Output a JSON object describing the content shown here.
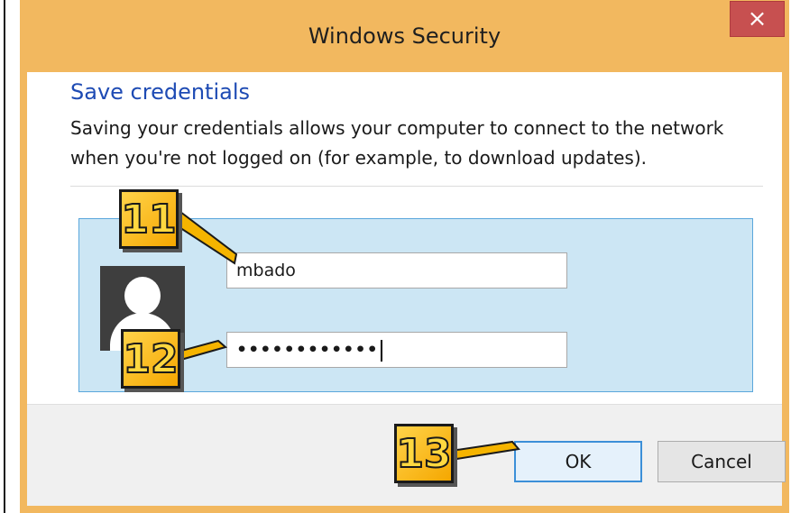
{
  "window": {
    "title": "Windows Security",
    "close_glyph": "×"
  },
  "dialog": {
    "heading": "Save credentials",
    "description": "Saving your credentials allows your computer to connect to the network when you're not logged on (for example, to download updates)."
  },
  "fields": {
    "username_value": "mbado",
    "password_masked": "••••••••••••"
  },
  "buttons": {
    "ok": "OK",
    "cancel": "Cancel"
  },
  "callouts": [
    "11",
    "12",
    "13"
  ],
  "icons": {
    "avatar": "user-avatar-icon",
    "close": "close-icon"
  },
  "colors": {
    "frame": "#f2b85f",
    "close": "#c75050",
    "heading": "#1e4bb4",
    "panel": "#cce6f4",
    "panel_border": "#5ba7dc",
    "callout": "#ffd34a"
  }
}
